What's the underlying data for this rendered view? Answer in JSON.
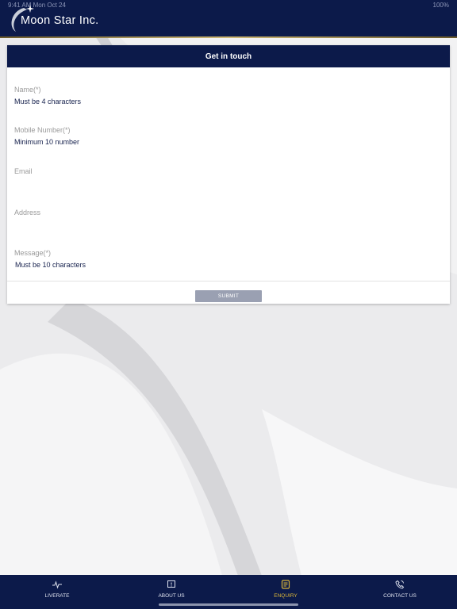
{
  "status_bar": {
    "time": "9:41 AM Mon Oct 24",
    "battery": "100%"
  },
  "header": {
    "logo_text": "Moon Star Inc."
  },
  "form": {
    "title": "Get in touch",
    "fields": [
      {
        "label": "Name(*)",
        "value": "Must be 4 characters"
      },
      {
        "label": "Mobile Number(*)",
        "value": "Minimum 10 number"
      },
      {
        "label": "Email",
        "value": ""
      },
      {
        "label": "Address",
        "value": ""
      },
      {
        "label": "Message(*)",
        "value": "Must be 10 characters"
      }
    ],
    "submit_label": "SUBMIT"
  },
  "tabs": [
    {
      "label": "LIVERATE",
      "icon": "pulse-icon",
      "active": false
    },
    {
      "label": "ABOUT US",
      "icon": "info-icon",
      "active": false
    },
    {
      "label": "ENQUIRY",
      "icon": "enquiry-icon",
      "active": true
    },
    {
      "label": "CONTACT US",
      "icon": "phone-icon",
      "active": false
    }
  ],
  "colors": {
    "brand_navy": "#0c1a4a",
    "accent_gold": "#d9b53a",
    "submit_gray": "#9aa0b2"
  }
}
